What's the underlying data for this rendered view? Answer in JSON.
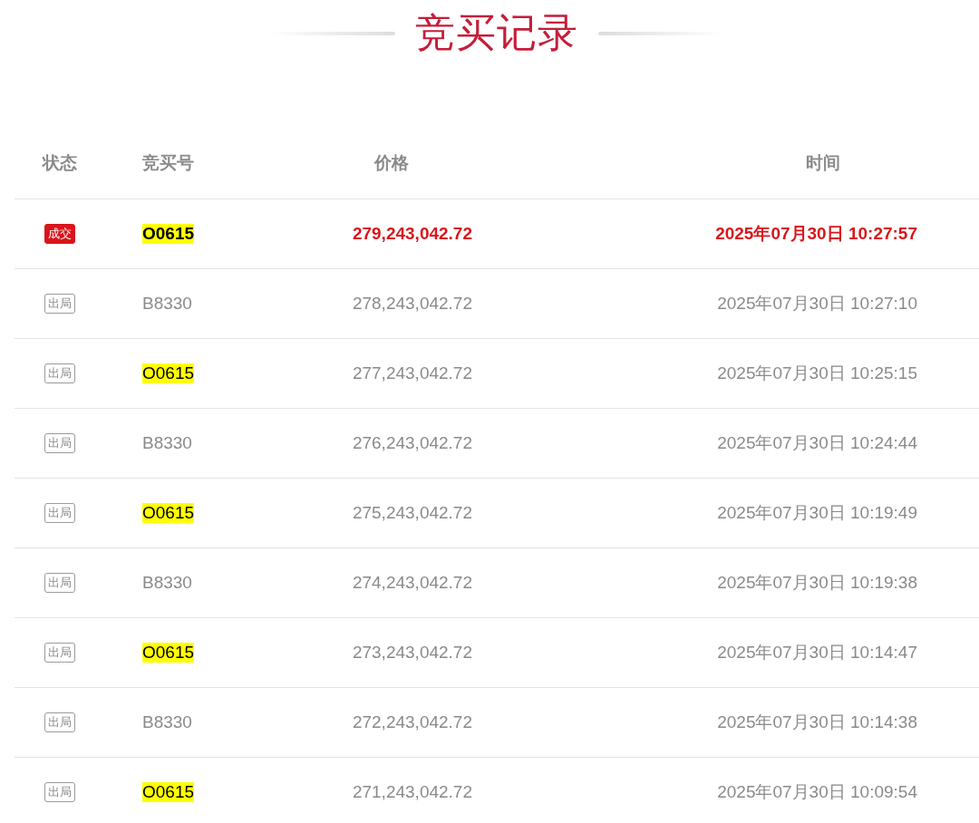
{
  "title": "竞买记录",
  "table": {
    "columns": [
      "状态",
      "竞买号",
      "价格",
      "时间"
    ],
    "rows": [
      {
        "status": {
          "kind": "won",
          "label": "成交"
        },
        "bidder": "O0615",
        "highlighted": true,
        "price": "279,243,042.72",
        "time": "2025年07月30日 10:27:57"
      },
      {
        "status": {
          "kind": "out",
          "label": "出局"
        },
        "bidder": "B8330",
        "highlighted": false,
        "price": "278,243,042.72",
        "time": "2025年07月30日 10:27:10"
      },
      {
        "status": {
          "kind": "out",
          "label": "出局"
        },
        "bidder": "O0615",
        "highlighted": true,
        "price": "277,243,042.72",
        "time": "2025年07月30日 10:25:15"
      },
      {
        "status": {
          "kind": "out",
          "label": "出局"
        },
        "bidder": "B8330",
        "highlighted": false,
        "price": "276,243,042.72",
        "time": "2025年07月30日 10:24:44"
      },
      {
        "status": {
          "kind": "out",
          "label": "出局"
        },
        "bidder": "O0615",
        "highlighted": true,
        "price": "275,243,042.72",
        "time": "2025年07月30日 10:19:49"
      },
      {
        "status": {
          "kind": "out",
          "label": "出局"
        },
        "bidder": "B8330",
        "highlighted": false,
        "price": "274,243,042.72",
        "time": "2025年07月30日 10:19:38"
      },
      {
        "status": {
          "kind": "out",
          "label": "出局"
        },
        "bidder": "O0615",
        "highlighted": true,
        "price": "273,243,042.72",
        "time": "2025年07月30日 10:14:47"
      },
      {
        "status": {
          "kind": "out",
          "label": "出局"
        },
        "bidder": "B8330",
        "highlighted": false,
        "price": "272,243,042.72",
        "time": "2025年07月30日 10:14:38"
      },
      {
        "status": {
          "kind": "out",
          "label": "出局"
        },
        "bidder": "O0615",
        "highlighted": true,
        "price": "271,243,042.72",
        "time": "2025年07月30日 10:09:54"
      }
    ]
  }
}
